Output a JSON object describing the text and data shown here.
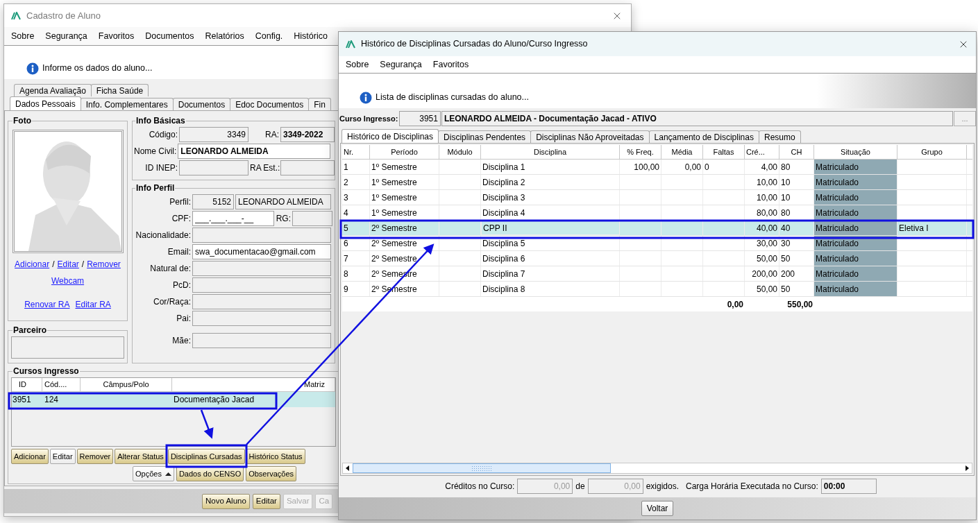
{
  "main_window": {
    "title": "Cadastro de Aluno",
    "menu": [
      "Sobre",
      "Segurança",
      "Favoritos",
      "Documentos",
      "Relatórios",
      "Config.",
      "Histórico"
    ],
    "info": "Informe os dados do aluno...",
    "tabs_upper": [
      {
        "label": "Agenda Avaliação",
        "selected": false
      },
      {
        "label": "Ficha Saúde",
        "selected": false
      }
    ],
    "tabs": [
      {
        "label": "Dados Pessoais",
        "selected": true
      },
      {
        "label": "Info. Complementares",
        "selected": false
      },
      {
        "label": "Documentos",
        "selected": false
      },
      {
        "label": "Edoc Documentos",
        "selected": false
      },
      {
        "label": "Fin",
        "selected": false
      }
    ],
    "photo": {
      "title": "Foto",
      "actions": [
        {
          "kind": "link",
          "text": "Adicionar"
        },
        {
          "kind": "separator",
          "text": "/"
        },
        {
          "kind": "link",
          "text": "Editar"
        },
        {
          "kind": "separator",
          "text": "/"
        },
        {
          "kind": "link",
          "text": "Remover"
        }
      ],
      "webcam": "Webcam",
      "ra_links": [
        "Renovar RA",
        "Editar RA"
      ]
    },
    "partner": {
      "title": "Parceiro"
    },
    "basic_info": {
      "title": "Info Básicas",
      "code_label": "Código:",
      "code": "3349",
      "ra_label": "RA:",
      "ra": "3349-2022",
      "name_label": "Nome Civil:",
      "name": "LEONARDO ALMEIDA",
      "inep_label": "ID INEP:",
      "ra_est_label": "RA Est.:"
    },
    "profile": {
      "title": "Info Perfil",
      "profile_label": "Perfil:",
      "profile_id": "5152",
      "profile_name": "LEONARDO ALMEIDA",
      "cpf_label": "CPF:",
      "cpf": "___.___.___-__",
      "rg_label": "RG:",
      "fields": [
        {
          "label": "Nacionalidade:"
        },
        {
          "label": "Email:",
          "value": "swa_documentacao@gmail.com"
        },
        {
          "label": "Natural de:"
        },
        {
          "label": "PcD:"
        },
        {
          "label": "Cor/Raça:"
        },
        {
          "label": "Pai:"
        },
        {
          "label": "Mãe:"
        }
      ]
    },
    "courses": {
      "title": "Cursos Ingresso",
      "columns": [
        "ID",
        "Cód....",
        "Câmpus/Polo",
        "Matriz"
      ],
      "rows": [
        {
          "id": "3951",
          "code": "124",
          "matrix": "Documentação Jacad",
          "selected": true
        }
      ],
      "buttons": [
        {
          "label": "Adicionar",
          "kind": "highlighted"
        },
        {
          "label": "Editar",
          "kind": "plain"
        },
        {
          "label": "Remover",
          "kind": "highlighted"
        },
        {
          "label": "Alterar Status",
          "kind": "highlighted"
        },
        {
          "label": "Disciplinas Cursadas",
          "kind": "highlighted"
        },
        {
          "label": "Histórico Status",
          "kind": "highlighted"
        }
      ],
      "buttons_second": [
        {
          "label": "Opções",
          "kind": "dropdown"
        },
        {
          "label": "Dados do CENSO",
          "kind": "highlighted"
        },
        {
          "label": "Observações",
          "kind": "highlighted"
        }
      ]
    },
    "footer_buttons": [
      {
        "label": "Novo Aluno",
        "disabled": false
      },
      {
        "label": "Editar",
        "disabled": false
      },
      {
        "label": "Salvar",
        "disabled": true
      },
      {
        "label": "Ca",
        "disabled": true
      }
    ]
  },
  "history_window": {
    "title": "Histórico de Disciplinas Cursadas do Aluno/Curso Ingresso",
    "menu": [
      "Sobre",
      "Segurança",
      "Favoritos"
    ],
    "info": "Lista de disciplinas cursadas do aluno...",
    "course": {
      "label": "Curso Ingresso:",
      "id": "3951",
      "name": "LEONARDO ALMEIDA - Documentação Jacad - ATIVO",
      "button": "..."
    },
    "tabs": [
      {
        "label": "Histórico de Disciplinas",
        "selected": true
      },
      {
        "label": "Disciplinas Pendentes",
        "selected": false
      },
      {
        "label": "Disciplinas Não Aproveitadas",
        "selected": false
      },
      {
        "label": "Lançamento de Disciplinas",
        "selected": false
      },
      {
        "label": "Resumo",
        "selected": false
      }
    ],
    "columns": [
      "Nr.",
      "Período",
      "Módulo",
      "Disciplina",
      "% Freq.",
      "Média",
      "Faltas",
      "Cré...",
      "CH",
      "Situação",
      "Grupo"
    ],
    "rows": [
      {
        "nr": "1",
        "period": "1º Semestre",
        "subject": "Disciplina 1",
        "freq": "100,00",
        "grade": "0,00",
        "absences": "0",
        "credits": "4,00",
        "ch": "80",
        "status": "Matriculado",
        "selected": false
      },
      {
        "nr": "2",
        "period": "1º Semestre",
        "subject": "Disciplina 2",
        "credits": "10,00",
        "ch": "10",
        "status": "Matriculado",
        "selected": false
      },
      {
        "nr": "3",
        "period": "1º Semestre",
        "subject": "Disciplina 3",
        "credits": "10,00",
        "ch": "10",
        "status": "Matriculado",
        "selected": false
      },
      {
        "nr": "4",
        "period": "1º Semestre",
        "subject": "Disciplina 4",
        "credits": "80,00",
        "ch": "80",
        "status": "Matriculado",
        "selected": false
      },
      {
        "nr": "5",
        "period": "2º Semestre",
        "subject": "CPP II",
        "credits": "40,00",
        "ch": "40",
        "status": "Matriculado",
        "group": "Eletiva I",
        "selected": true
      },
      {
        "nr": "6",
        "period": "2º Semestre",
        "subject": "Disciplina 5",
        "credits": "30,00",
        "ch": "30",
        "status": "Matriculado",
        "selected": false
      },
      {
        "nr": "7",
        "period": "2º Semestre",
        "subject": "Disciplina 6",
        "credits": "50,00",
        "ch": "50",
        "status": "Matriculado",
        "selected": false
      },
      {
        "nr": "8",
        "period": "2º Semestre",
        "subject": "Disciplina 7",
        "credits": "200,00",
        "ch": "200",
        "status": "Matriculado",
        "selected": false
      },
      {
        "nr": "9",
        "period": "2º Semestre",
        "subject": "Disciplina 8",
        "credits": "50,00",
        "ch": "50",
        "status": "Matriculado",
        "selected": false
      }
    ],
    "totals": {
      "absences": "0,00",
      "ch": "550,00"
    },
    "summary": {
      "credits_label": "Créditos no Curso:",
      "credits": "0,00",
      "of_label": "de",
      "required": "0,00",
      "required_label": "exigidos.",
      "hours_label": "Carga Horária Executada no Curso:",
      "hours": "00:00"
    },
    "button": "Voltar"
  }
}
